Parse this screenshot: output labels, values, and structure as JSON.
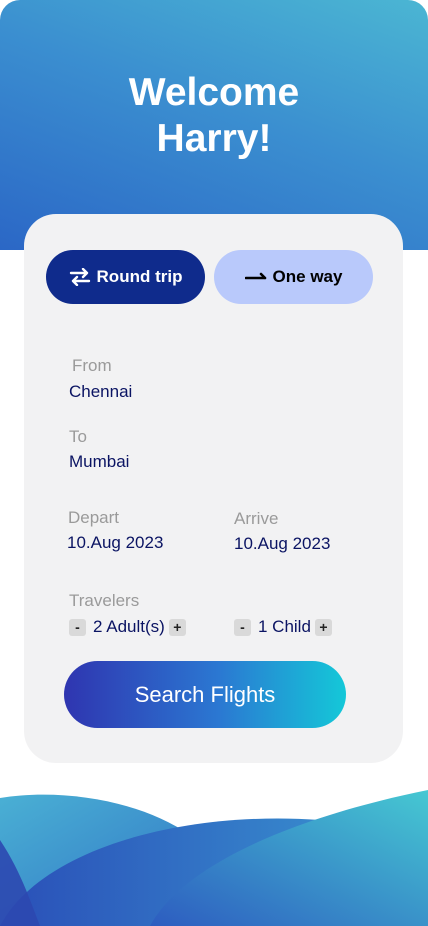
{
  "header": {
    "welcome_line1": "Welcome",
    "welcome_line2": "Harry!"
  },
  "trip_type": {
    "round_trip_label": "Round trip",
    "one_way_label": "One way",
    "selected": "Round trip"
  },
  "form": {
    "from_label": "From",
    "from_value": "Chennai",
    "to_label": "To",
    "to_value": "Mumbai",
    "depart_label": "Depart",
    "depart_value": "10.Aug 2023",
    "arrive_label": "Arrive",
    "arrive_value": "10.Aug 2023",
    "travelers_label": "Travelers",
    "adults_value": "2 Adult(s)",
    "child_value": "1 Child",
    "minus_symbol": "-",
    "plus_symbol": "+"
  },
  "search_button_label": "Search Flights",
  "colors": {
    "primary": "#0f2b8c",
    "secondary_pill": "#b9c9fb",
    "header_gradient_start": "#2b67c6",
    "header_gradient_end": "#4bb6d3",
    "card_bg": "#f2f2f3",
    "value_text": "#0b1463",
    "label_text": "#9a9a9a"
  },
  "icons": {
    "round_trip": "swap-arrows-icon",
    "one_way": "right-arrow-icon"
  }
}
